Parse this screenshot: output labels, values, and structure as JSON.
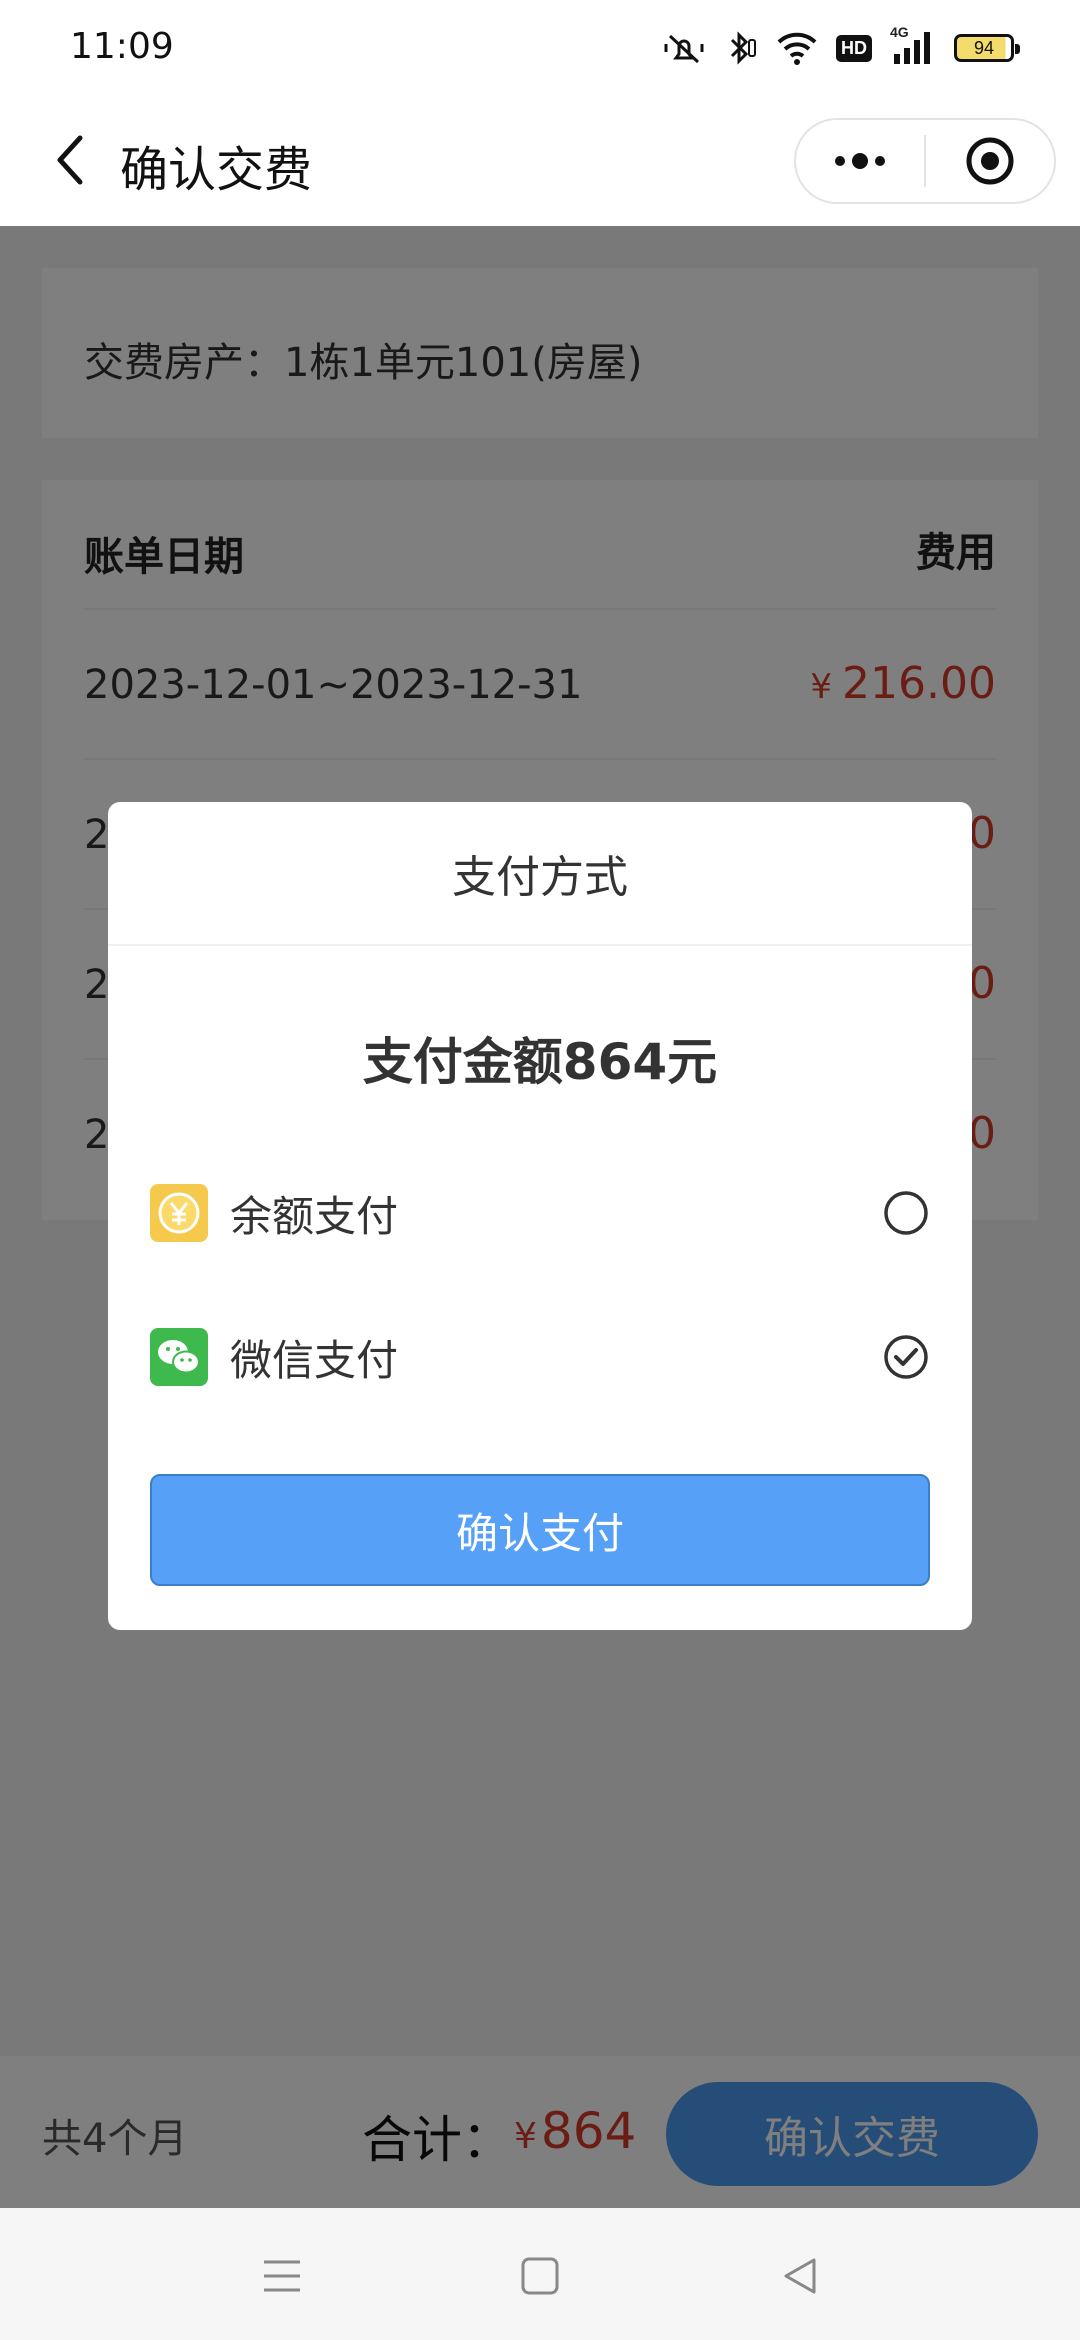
{
  "status_bar": {
    "time": "11:09",
    "hd": "HD",
    "network": "4G",
    "battery": "94",
    "icons": [
      "mute-icon",
      "bluetooth-icon",
      "wifi-icon",
      "hd-icon",
      "signal-icon",
      "battery-icon"
    ]
  },
  "header": {
    "title": "确认交费"
  },
  "property": {
    "text": "交费房产：1栋1单元101(房屋)"
  },
  "bills": {
    "col_date": "账单日期",
    "col_fee": "费用",
    "currency": "¥",
    "rows": [
      {
        "date": "2023-12-01~2023-12-31",
        "amount": "216.00"
      },
      {
        "date": "2",
        "amount": "0"
      },
      {
        "date": "2",
        "amount": "0"
      },
      {
        "date": "2",
        "amount": "0"
      }
    ]
  },
  "bottom": {
    "months": "共4个月",
    "total_label": "合计：",
    "currency": "¥",
    "total_value": "864",
    "confirm_label": "确认交费"
  },
  "modal": {
    "title": "支付方式",
    "amount": "支付金额864元",
    "options": [
      {
        "label": "余额支付",
        "icon": "yuan-coin-icon",
        "selected": false
      },
      {
        "label": "微信支付",
        "icon": "wechat-icon",
        "selected": true
      }
    ],
    "confirm_label": "确认支付"
  },
  "colors": {
    "accent": "#56a1f7",
    "price": "#d53a2a",
    "wechat": "#3eb94e",
    "balance": "#f5c94c"
  }
}
